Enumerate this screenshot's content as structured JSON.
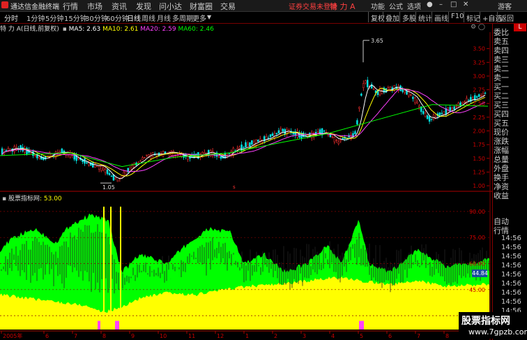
{
  "titlebar": {
    "app_name": "通达信金融终端",
    "menu": [
      "行情",
      "市场",
      "资讯",
      "发现",
      "问小达",
      "财富圈",
      "交易"
    ],
    "warning": "证券交易未登录",
    "stock_name": "特 力 A",
    "right": [
      "功能",
      "公式",
      "选项",
      "游客"
    ]
  },
  "toolbar": {
    "timeframes": [
      "分时",
      "1分钟",
      "5分钟",
      "15分钟",
      "30分钟",
      "60分钟",
      "日线",
      "周线",
      "月线",
      "多周期",
      "更多"
    ],
    "active": "日线",
    "right_buttons": [
      "复权",
      "叠加",
      "多股",
      "统计",
      "画线",
      "F10",
      "标记",
      "+自选",
      "返回"
    ]
  },
  "infoline": {
    "stock": "特 力 A",
    "mode": "(日线,前复权)",
    "ma": [
      {
        "label": "MA5: 2.63",
        "color": "#ffffff"
      },
      {
        "label": "MA10: 2.61",
        "color": "#ffff00"
      },
      {
        "label": "MA20: 2.59",
        "color": "#ff40ff"
      },
      {
        "label": "MA60: 2.46",
        "color": "#00ff00"
      }
    ]
  },
  "indicator": {
    "name": "股票指标网",
    "value": ": 53.00",
    "last_badge": "44.84"
  },
  "side": {
    "items": [
      "委比",
      "卖五",
      "卖四",
      "卖三",
      "卖二",
      "卖一",
      "买一",
      "买二",
      "买三",
      "买四",
      "买五",
      "现价",
      "涨跌",
      "涨幅",
      "总量",
      "外盘",
      "换手",
      "净资",
      "收益",
      "自动",
      "行情"
    ],
    "time_items": [
      "14:56",
      "14:56",
      "14:56",
      "14:56",
      "14:56",
      "14:56",
      "14:56",
      "14:56",
      "14:56"
    ],
    "corner": "L",
    "corner_small": "R"
  },
  "chart_data": [
    {
      "type": "candlestick",
      "title": "",
      "ylim": [
        0.95,
        3.75
      ],
      "y_ticks": [
        1.0,
        1.25,
        1.5,
        1.75,
        2.0,
        2.25,
        2.5,
        2.75,
        3.0,
        3.25,
        3.5
      ],
      "y_tick_labels": [
        "1.00",
        "1.25",
        "1.50",
        "1.75",
        "2.00",
        "2.25",
        "2.50",
        "2.75",
        "3.00",
        "3.25",
        "3.50"
      ],
      "annotations": [
        {
          "text": "3.65",
          "value": 3.65
        },
        {
          "text": "1.05",
          "value": 1.05
        }
      ],
      "guide_points": [
        [
          0,
          1.62
        ],
        [
          30,
          1.68
        ],
        [
          60,
          1.5
        ],
        [
          90,
          1.62
        ],
        [
          120,
          1.45
        ],
        [
          150,
          1.3
        ],
        [
          168,
          1.1
        ],
        [
          185,
          1.3
        ],
        [
          210,
          1.55
        ],
        [
          240,
          1.6
        ],
        [
          270,
          1.52
        ],
        [
          300,
          1.6
        ],
        [
          320,
          1.52
        ],
        [
          350,
          1.72
        ],
        [
          380,
          1.85
        ],
        [
          405,
          2.0
        ],
        [
          440,
          1.9
        ],
        [
          465,
          2.0
        ],
        [
          485,
          1.8
        ],
        [
          510,
          1.95
        ],
        [
          520,
          2.8
        ],
        [
          525,
          2.9
        ],
        [
          540,
          2.7
        ],
        [
          570,
          2.8
        ],
        [
          590,
          2.65
        ],
        [
          615,
          2.2
        ],
        [
          640,
          2.35
        ],
        [
          670,
          2.55
        ],
        [
          700,
          2.7
        ]
      ],
      "series": [
        {
          "name": "MA5",
          "color": "#ffffff",
          "values": []
        },
        {
          "name": "MA10",
          "color": "#ffff00",
          "values": []
        },
        {
          "name": "MA20",
          "color": "#ff40ff",
          "values": []
        },
        {
          "name": "MA60",
          "color": "#00ff00",
          "values": []
        }
      ],
      "ma_guide": {
        "MA60": [
          [
            0,
            1.55
          ],
          [
            100,
            1.6
          ],
          [
            175,
            1.35
          ],
          [
            250,
            1.52
          ],
          [
            330,
            1.6
          ],
          [
            400,
            1.78
          ],
          [
            470,
            1.95
          ],
          [
            540,
            2.2
          ],
          [
            620,
            2.48
          ],
          [
            700,
            2.45
          ]
        ]
      }
    },
    {
      "type": "area",
      "title": "",
      "ylim": [
        22,
        100
      ],
      "y_ticks": [
        30,
        45,
        60,
        75,
        90
      ],
      "y_tick_labels": [
        "30.00",
        "45.00",
        "60.00",
        "75.00",
        "90.00"
      ],
      "x_tick_labels": [
        "2005年",
        "6",
        "7",
        "8",
        "9",
        "10",
        "11",
        "12",
        "1",
        "2",
        "3",
        "4",
        "5",
        "6",
        "7",
        "8",
        "9"
      ],
      "series": [
        {
          "name": "绿",
          "color": "#00ff00",
          "guide": [
            [
              0,
              68
            ],
            [
              20,
              75
            ],
            [
              50,
              80
            ],
            [
              80,
              72
            ],
            [
              100,
              82
            ],
            [
              130,
              88
            ],
            [
              155,
              85
            ],
            [
              175,
              55
            ],
            [
              200,
              65
            ],
            [
              240,
              60
            ],
            [
              265,
              70
            ],
            [
              300,
              80
            ],
            [
              330,
              78
            ],
            [
              350,
              60
            ],
            [
              380,
              65
            ],
            [
              410,
              55
            ],
            [
              440,
              60
            ],
            [
              470,
              70
            ],
            [
              490,
              60
            ],
            [
              515,
              85
            ],
            [
              530,
              60
            ],
            [
              560,
              55
            ],
            [
              580,
              62
            ],
            [
              600,
              68
            ],
            [
              640,
              58
            ],
            [
              670,
              60
            ],
            [
              700,
              62
            ]
          ]
        },
        {
          "name": "黄",
          "color": "#ffff00",
          "guide": [
            [
              0,
              42
            ],
            [
              40,
              40
            ],
            [
              80,
              38
            ],
            [
              120,
              36
            ],
            [
              150,
              32
            ],
            [
              175,
              35
            ],
            [
              200,
              40
            ],
            [
              240,
              43
            ],
            [
              280,
              42
            ],
            [
              320,
              45
            ],
            [
              360,
              47
            ],
            [
              400,
              48
            ],
            [
              440,
              50
            ],
            [
              480,
              52
            ],
            [
              520,
              50
            ],
            [
              560,
              48
            ],
            [
              600,
              50
            ],
            [
              640,
              47
            ],
            [
              700,
              48
            ]
          ]
        }
      ]
    }
  ]
}
